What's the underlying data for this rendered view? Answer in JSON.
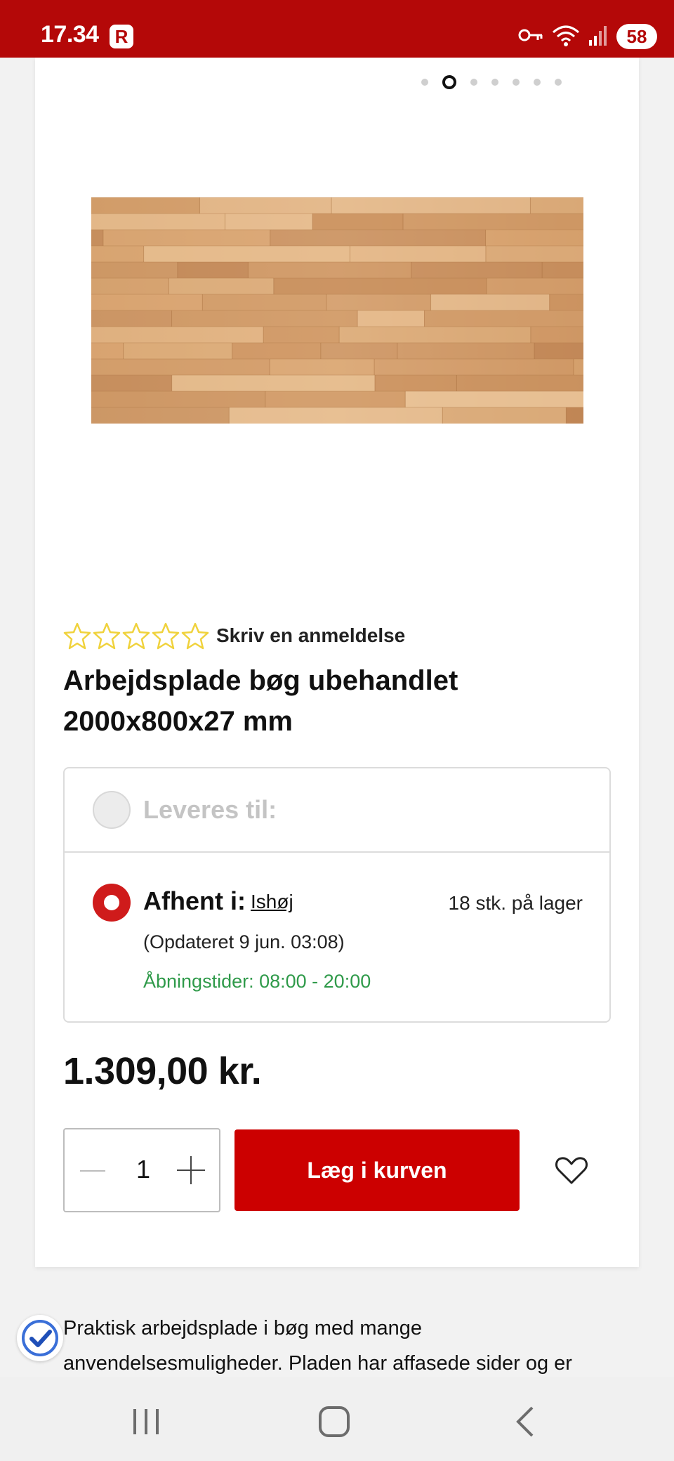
{
  "status_bar": {
    "time": "17.34",
    "app_badge": "R",
    "battery": "58"
  },
  "carousel": {
    "count": 7,
    "active_index": 1
  },
  "product": {
    "review_link": "Skriv en anmeldelse",
    "rating": 0,
    "rating_max": 5,
    "title": "Arbejdsplade bøg ubehandlet 2000x800x27 mm",
    "price": "1.309,00 kr."
  },
  "fulfillment": {
    "delivery_label": "Leveres til:",
    "pickup_label": "Afhent i:",
    "store_name": "Ishøj",
    "stock": "18 stk. på lager",
    "updated": "(Opdateret 9 jun. 03:08)",
    "opening_hours": "Åbningstider: 08:00 - 20:00"
  },
  "purchase": {
    "quantity": "1",
    "add_to_cart_label": "Læg i kurven"
  },
  "description": {
    "text": "Praktisk arbejdsplade i bøg med mange anvendelsesmuligheder. Pladen har affasede sider og er"
  },
  "colors": {
    "brand_red": "#cc0000",
    "status_bar": "#b40808",
    "open_green": "#2f9a4a",
    "star_yellow": "#f0d23c"
  }
}
